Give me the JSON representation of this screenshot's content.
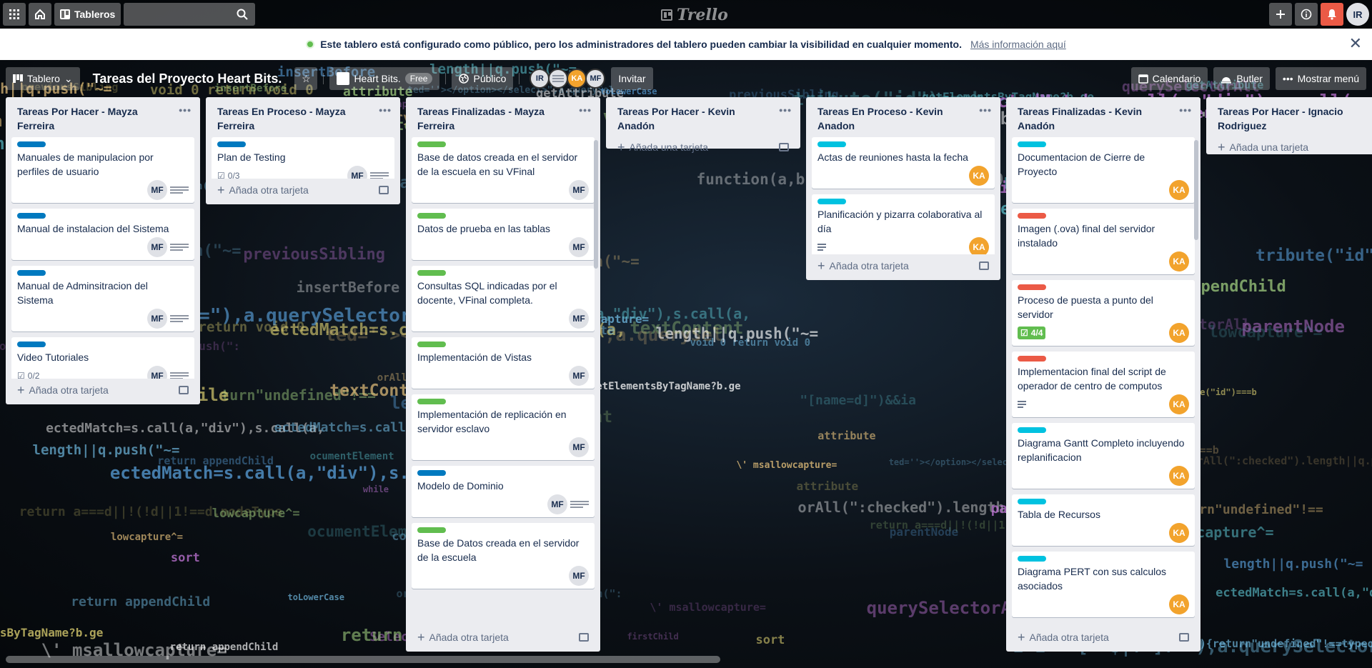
{
  "topbar": {
    "boards_label": "Tableros",
    "logo_text": "Trello",
    "user_initials": "IR"
  },
  "banner": {
    "message": "Este tablero está configurado como público, pero los administradores del tablero pueden cambiar la visibilidad en cualquier momento.",
    "link": "Más información aquí"
  },
  "board": {
    "view_label": "Tablero",
    "title": "Tareas del Proyecto Heart Bits.",
    "workspace": "Heart Bits.",
    "workspace_plan": "Free",
    "visibility": "Público",
    "members": [
      "IR",
      "",
      "KA",
      "MF"
    ],
    "invite_label": "Invitar",
    "calendar_label": "Calendario",
    "butler_label": "Butler",
    "menu_label": "Mostrar menú"
  },
  "colors": {
    "blue": "#0079bf",
    "green": "#61bd4f",
    "sky": "#00c2e0",
    "red": "#eb5a46",
    "orange_avatar": "#f2a32d"
  },
  "add_card_label": "Añada otra tarjeta",
  "add_card_first_label": "Añada una tarjeta",
  "lists": [
    {
      "title": "Tareas Por Hacer - Mayza Ferreira",
      "cards": [
        {
          "title": "Manuales de manipulacion por perfiles de usuario",
          "label": "blue",
          "member": "MF",
          "logo": true
        },
        {
          "title": "Manual de instalacion del Sistema",
          "label": "blue",
          "member": "MF",
          "logo": true
        },
        {
          "title": "Manual de Adminsitracion del Sistema",
          "label": "blue",
          "member": "MF",
          "logo": true
        },
        {
          "title": "Video Tutoriales",
          "label": "blue",
          "member": "MF",
          "logo": true,
          "checklist": "0/2"
        }
      ]
    },
    {
      "title": "Tareas En Proceso - Mayza Ferreira",
      "cards": [
        {
          "title": "Plan de Testing",
          "label": "blue",
          "member": "MF",
          "logo": true,
          "checklist": "0/3"
        }
      ]
    },
    {
      "title": "Tareas Finalizadas - Mayza Ferreira",
      "cards": [
        {
          "title": "Base de datos creada en el servidor de la escuela en su VFinal",
          "label": "green",
          "member": "MF"
        },
        {
          "title": "Datos de prueba en las tablas",
          "label": "green",
          "member": "MF"
        },
        {
          "title": "Consultas SQL indicadas por el docente, VFinal completa.",
          "label": "green",
          "member": "MF"
        },
        {
          "title": "Implementación de Vistas",
          "label": "green",
          "member": "MF"
        },
        {
          "title": "Implementación de replicación en servidor esclavo",
          "label": "green",
          "member": "MF"
        },
        {
          "title": "Modelo de Dominio",
          "label": "blue",
          "member": "MF",
          "logo": true
        },
        {
          "title": "Base de Datos creada en el servidor de la escuela",
          "label": "green",
          "member": "MF"
        }
      ]
    },
    {
      "title": "Tareas Por Hacer - Kevin Anadón",
      "cards": []
    },
    {
      "title": "Tareas En Proceso - Kevin Anadon",
      "cards": [
        {
          "title": "Actas de reuniones hasta la fecha",
          "label": "sky",
          "member": "KA"
        },
        {
          "title": "Planificación y pizarra colaborativa al día",
          "label": "sky",
          "member": "KA",
          "desc": true
        }
      ]
    },
    {
      "title": "Tareas Finalizadas - Kevin Anadón",
      "cards": [
        {
          "title": "Documentacion de Cierre de Proyecto",
          "label": "sky",
          "member": "KA"
        },
        {
          "title": "Imagen (.ova) final del servidor instalado",
          "label": "red",
          "member": "KA"
        },
        {
          "title": "Proceso de puesta a punto del servidor",
          "label": "red",
          "member": "KA",
          "checklist_done": "4/4"
        },
        {
          "title": "Implementacion final del script de operador de centro de computos",
          "label": "red",
          "member": "KA",
          "desc": true
        },
        {
          "title": "Diagrama Gantt Completo incluyendo replanificacion",
          "label": "sky",
          "member": "KA"
        },
        {
          "title": "Tabla de Recursos",
          "label": "sky",
          "member": "KA"
        },
        {
          "title": "Diagrama PERT con sus calculos asociados",
          "label": "sky",
          "member": "KA"
        }
      ]
    },
    {
      "title": "Tareas Por Hacer - Ignacio Rodriguez",
      "cards": []
    }
  ]
}
